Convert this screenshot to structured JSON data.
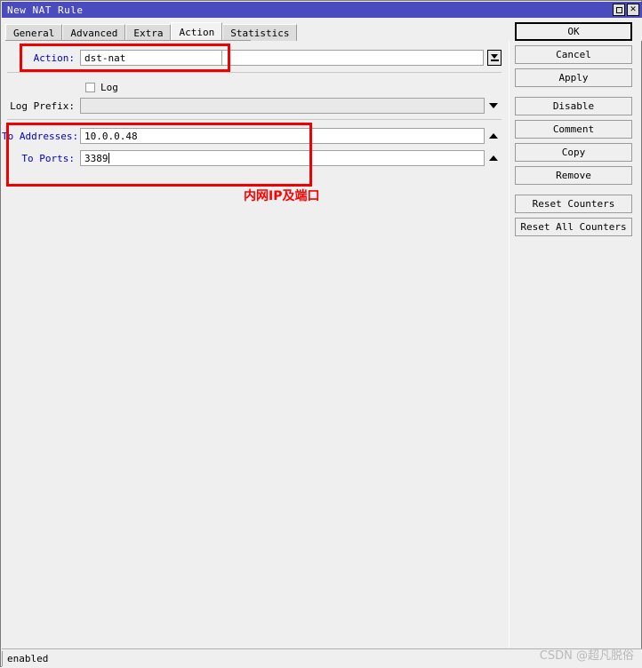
{
  "window": {
    "title": "New NAT Rule",
    "controls": [
      {
        "name": "maximize",
        "glyph": "□"
      },
      {
        "name": "close",
        "glyph": "✕"
      }
    ]
  },
  "tabs": [
    {
      "label": "General",
      "active": false
    },
    {
      "label": "Advanced",
      "active": false
    },
    {
      "label": "Extra",
      "active": false
    },
    {
      "label": "Action",
      "active": true
    },
    {
      "label": "Statistics",
      "active": false
    }
  ],
  "form": {
    "action": {
      "label": "Action:",
      "value": "dst-nat",
      "placeholder": ""
    },
    "log": {
      "label": "Log",
      "checked": false
    },
    "log_prefix": {
      "label": "Log Prefix:",
      "value": "",
      "placeholder": ""
    },
    "to_addresses": {
      "label": "To Addresses:",
      "value": "10.0.0.48",
      "placeholder": ""
    },
    "to_ports": {
      "label": "To Ports:",
      "value": "3389",
      "placeholder": ""
    }
  },
  "annotation": {
    "text": "内网IP及端口",
    "color": "#ff0000"
  },
  "buttons": [
    {
      "label": "OK",
      "default": true
    },
    {
      "label": "Cancel",
      "default": false
    },
    {
      "label": "Apply",
      "default": false
    },
    {
      "label": "Disable",
      "default": false
    },
    {
      "label": "Comment",
      "default": false
    },
    {
      "label": "Copy",
      "default": false
    },
    {
      "label": "Remove",
      "default": false
    },
    {
      "label": "Reset Counters",
      "default": false
    },
    {
      "label": "Reset All Counters",
      "default": false
    }
  ],
  "statusbar": {
    "text": "enabled"
  },
  "watermark": {
    "text": "CSDN @超凡脱俗"
  },
  "colors": {
    "titlebar": "#4b4bc0",
    "window_bg": "#efefef",
    "label_blue": "#0000cc",
    "annotation_red": "#ff0000",
    "field_bg": "#ffffff",
    "field_disabled_bg": "#e9e9e9"
  }
}
